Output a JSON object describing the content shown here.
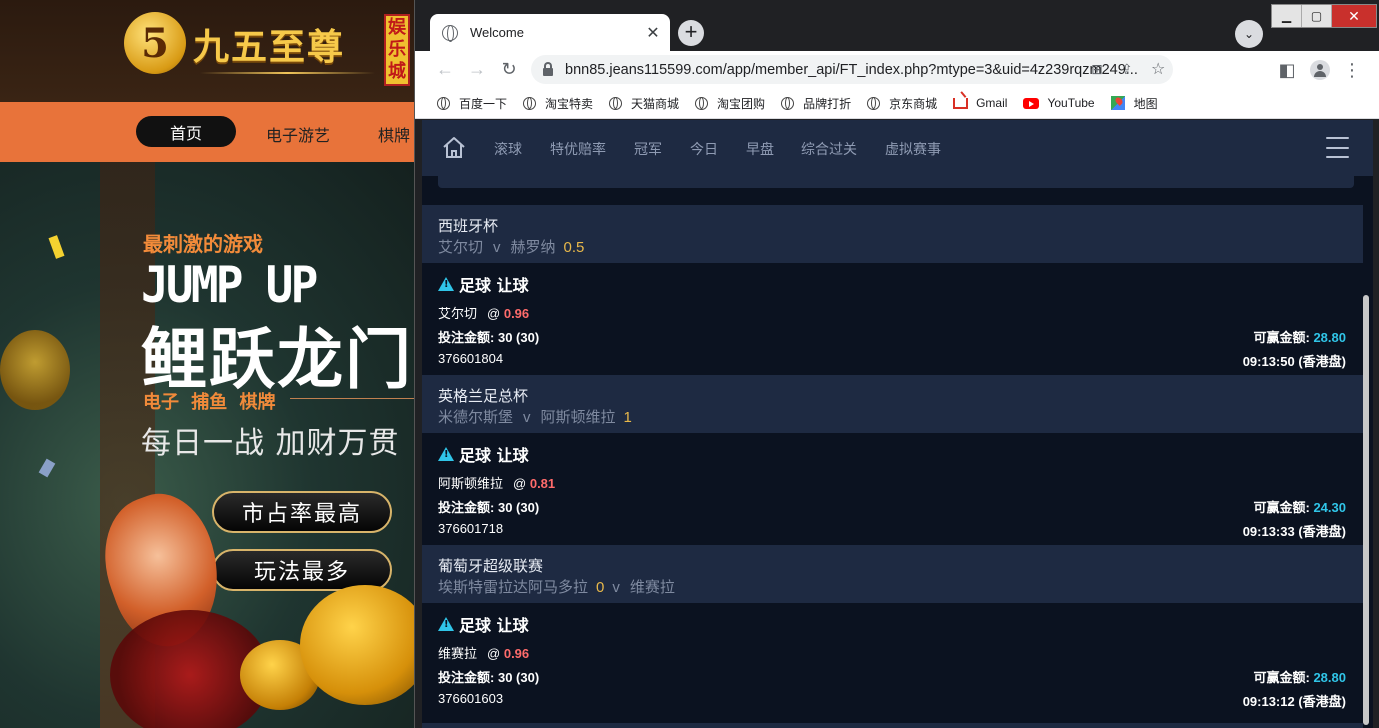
{
  "background_site": {
    "logo_mark": "5",
    "logo_text": "九五至尊",
    "logo_badge": [
      "娱",
      "乐",
      "城"
    ],
    "nav": [
      "首页",
      "电子游艺",
      "棋牌"
    ],
    "hero_sub": "最刺激的游戏",
    "hero_title_en": "JUMP UP",
    "hero_title_cn": "鲤跃龙门",
    "hero_tags": "电子 捕鱼 棋牌",
    "hero_slogan": "每日一战 加财万贯",
    "buttons": [
      "市占率最高",
      "玩法最多"
    ]
  },
  "browser": {
    "tab_title": "Welcome",
    "url": "bnn85.jeans115599.com/app/member_api/FT_index.php?mtype=3&uid=4z239rqzm249...",
    "bookmarks": [
      "百度一下",
      "淘宝特卖",
      "天猫商城",
      "淘宝团购",
      "品牌打折",
      "京东商城",
      "Gmail",
      "YouTube",
      "地图"
    ]
  },
  "app": {
    "nav": [
      "滚球",
      "特优赔率",
      "冠军",
      "今日",
      "早盘",
      "综合过关",
      "虚拟赛事"
    ],
    "labels": {
      "stake": "投注金额:",
      "win": "可赢金额:",
      "at": "@",
      "vs": "v"
    },
    "entries": [
      {
        "league": "西班牙杯",
        "home": "艾尔切",
        "away": "赫罗纳",
        "handicap": "0.5",
        "handicap_position": "end",
        "bet_type": "足球 让球",
        "pick": "艾尔切",
        "odds": "0.96",
        "stake": "30 (30)",
        "win": "28.80",
        "id": "376601804",
        "time": "09:13:50 (香港盘)"
      },
      {
        "league": "英格兰足总杯",
        "home": "米德尔斯堡",
        "away": "阿斯顿维拉",
        "handicap": "1",
        "handicap_position": "end",
        "bet_type": "足球 让球",
        "pick": "阿斯顿维拉",
        "odds": "0.81",
        "stake": "30 (30)",
        "win": "24.30",
        "id": "376601718",
        "time": "09:13:33 (香港盘)"
      },
      {
        "league": "葡萄牙超级联赛",
        "home": "埃斯特雷拉达阿马多拉",
        "away": "维赛拉",
        "handicap": "0",
        "handicap_position": "middle",
        "bet_type": "足球 让球",
        "pick": "维赛拉",
        "odds": "0.96",
        "stake": "30 (30)",
        "win": "28.80",
        "id": "376601603",
        "time": "09:13:12 (香港盘)"
      }
    ]
  }
}
